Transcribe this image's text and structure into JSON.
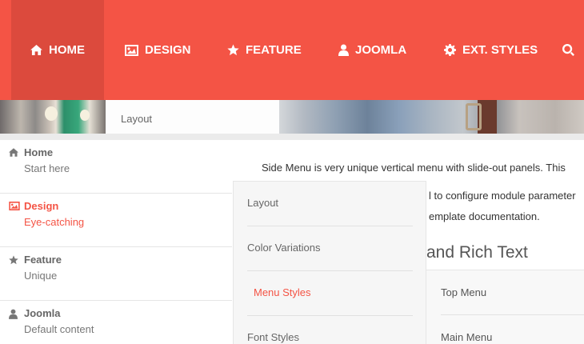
{
  "nav": {
    "items": [
      {
        "label": "HOME",
        "icon": "home-icon",
        "active": true
      },
      {
        "label": "DESIGN",
        "icon": "image-icon"
      },
      {
        "label": "FEATURE",
        "icon": "star-icon"
      },
      {
        "label": "JOOMLA",
        "icon": "user-icon"
      },
      {
        "label": "EXT. STYLES",
        "icon": "gear-icon"
      }
    ],
    "search_icon": "search-icon"
  },
  "banner": {
    "label": "Layout"
  },
  "side_menu": {
    "items": [
      {
        "title": "Home",
        "subtitle": "Start here",
        "icon": "home-icon"
      },
      {
        "title": "Design",
        "subtitle": "Eye-catching",
        "icon": "image-icon",
        "active": true
      },
      {
        "title": "Feature",
        "subtitle": "Unique",
        "icon": "star-icon"
      },
      {
        "title": "Joomla",
        "subtitle": "Default content",
        "icon": "user-icon"
      }
    ]
  },
  "content": {
    "line1": "Side Menu is very unique vertical menu with slide-out panels. This",
    "line2": "l to configure module parameter",
    "line3": "emplate documentation.",
    "heading": "and Rich Text"
  },
  "panel": {
    "items": [
      {
        "label": "Layout"
      },
      {
        "label": "Color Variations"
      },
      {
        "label": "Menu Styles",
        "active": true
      },
      {
        "label": "Font Styles"
      }
    ]
  },
  "subpanel": {
    "items": [
      {
        "label": "Top Menu"
      },
      {
        "label": "Main Menu"
      }
    ]
  },
  "colors": {
    "accent": "#f45445",
    "nav_active": "#dc4a3d",
    "panel_bg": "#f6f6f6"
  }
}
